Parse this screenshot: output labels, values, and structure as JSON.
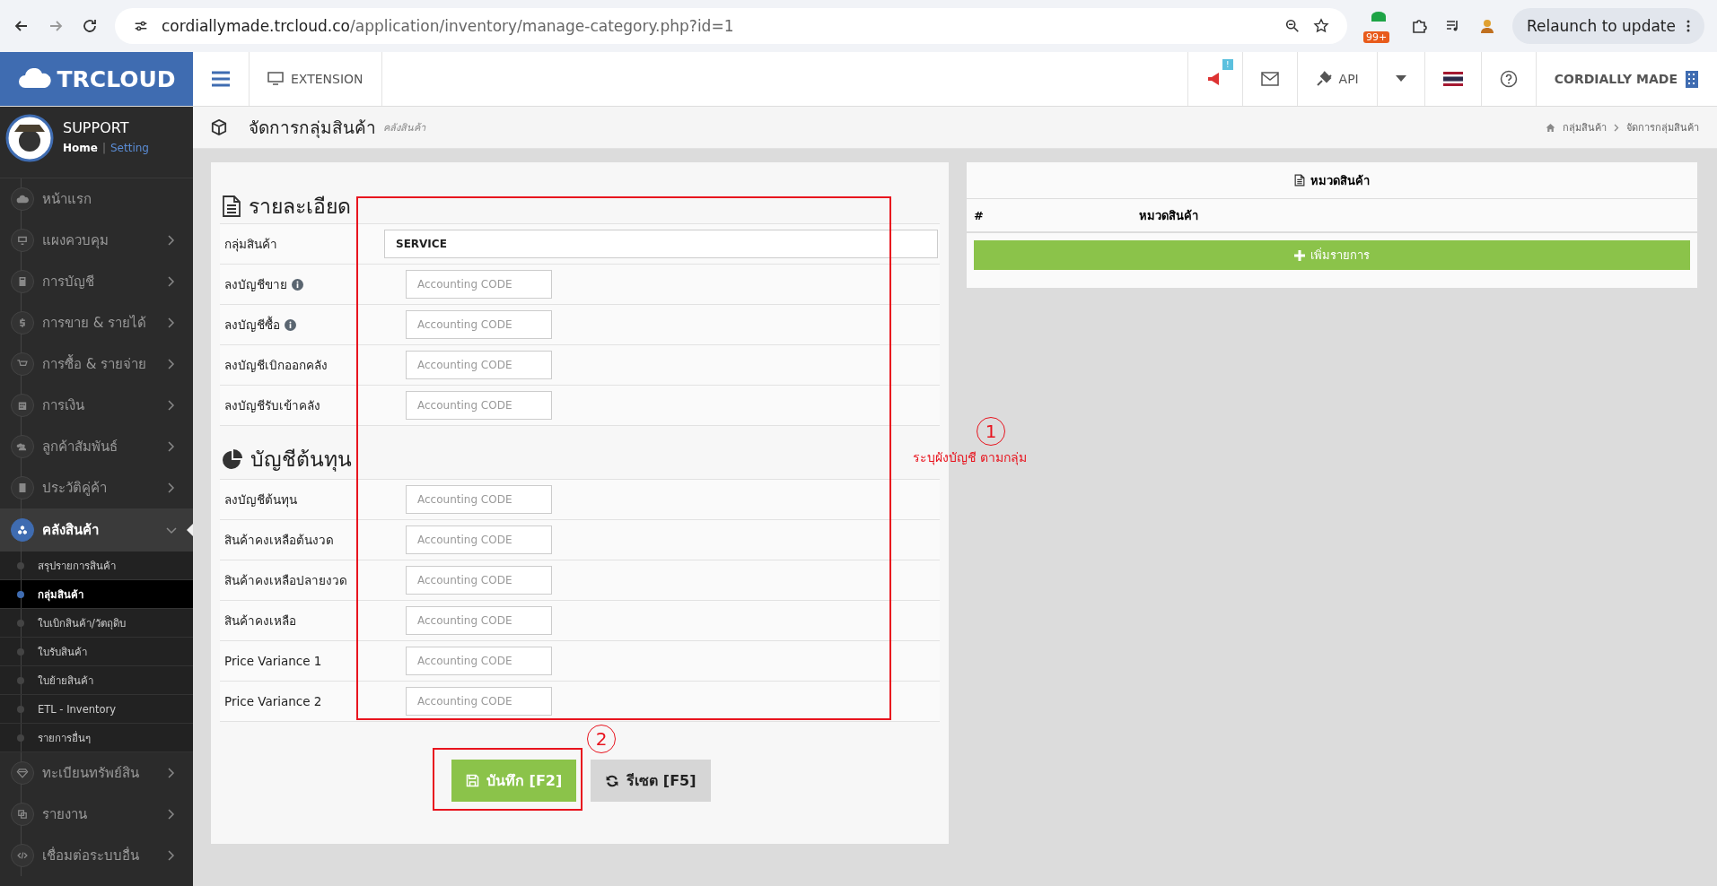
{
  "browser": {
    "url_host": "cordiallymade.trcloud.co",
    "url_path": "/application/inventory/manage-category.php?id=1",
    "extension_badge": "99+",
    "relaunch": "Relaunch to update"
  },
  "header": {
    "logo": "TRCLOUD",
    "extension": "EXTENSION",
    "notification_badge": "!",
    "api": "API",
    "company": "CORDIALLY MADE"
  },
  "user": {
    "name": "SUPPORT",
    "links": [
      {
        "label": "Home",
        "selected": true
      },
      {
        "label": "Setting",
        "selected": false
      }
    ],
    "separator": "|"
  },
  "sidebar": {
    "items": [
      {
        "label": "หน้าแรก",
        "selected": false
      },
      {
        "label": "แผงควบคุม",
        "selected": false,
        "expanded": false
      },
      {
        "label": "การบัญชี",
        "selected": false,
        "expanded": false
      },
      {
        "label": "การขาย & รายได้",
        "selected": false,
        "expanded": false
      },
      {
        "label": "การซื้อ & รายจ่าย",
        "selected": false,
        "expanded": false
      },
      {
        "label": "การเงิน",
        "selected": false,
        "expanded": false
      },
      {
        "label": "ลูกค้าสัมพันธ์",
        "selected": false,
        "expanded": false
      },
      {
        "label": "ประวัติคู่ค้า",
        "selected": false,
        "expanded": false
      },
      {
        "label": "คลังสินค้า",
        "selected": true,
        "expanded": true,
        "children": [
          {
            "label": "สรุปรายการสินค้า",
            "selected": false
          },
          {
            "label": "กลุ่มสินค้า",
            "selected": true
          },
          {
            "label": "ใบเบิกสินค้า/วัตถุดิบ",
            "selected": false
          },
          {
            "label": "ใบรับสินค้า",
            "selected": false
          },
          {
            "label": "ใบย้ายสินค้า",
            "selected": false
          },
          {
            "label": "ETL - Inventory",
            "selected": false
          },
          {
            "label": "รายการอื่นๆ",
            "selected": false
          }
        ]
      },
      {
        "label": "ทะเบียนทรัพย์สิน",
        "selected": false,
        "expanded": false
      },
      {
        "label": "รายงาน",
        "selected": false,
        "expanded": false
      },
      {
        "label": "เชื่อมต่อระบบอื่น",
        "selected": false,
        "expanded": false
      }
    ]
  },
  "page_header": {
    "title": "จัดการกลุ่มสินค้า",
    "subtitle": "คลังสินค้า",
    "breadcrumb": [
      "กลุ่มสินค้า",
      "จัดการกลุ่มสินค้า"
    ]
  },
  "form": {
    "sections": [
      {
        "title": "รายละเอียด",
        "rows": [
          {
            "kind": "text",
            "label": "กลุ่มสินค้า",
            "value": "SERVICE",
            "info": false
          },
          {
            "kind": "code",
            "label": "ลงบัญชีขาย",
            "placeholder": "Accounting CODE",
            "info": true
          },
          {
            "kind": "code",
            "label": "ลงบัญชีซื้อ",
            "placeholder": "Accounting CODE",
            "info": true
          },
          {
            "kind": "code",
            "label": "ลงบัญชีเบิกออกคลัง",
            "placeholder": "Accounting CODE",
            "info": false
          },
          {
            "kind": "code",
            "label": "ลงบัญชีรับเข้าคลัง",
            "placeholder": "Accounting CODE",
            "info": false
          }
        ]
      },
      {
        "title": "บัญชีต้นทุน",
        "rows": [
          {
            "kind": "code",
            "label": "ลงบัญชีต้นทุน",
            "placeholder": "Accounting CODE",
            "info": false
          },
          {
            "kind": "code",
            "label": "สินค้าคงเหลือต้นงวด",
            "placeholder": "Accounting CODE",
            "info": false
          },
          {
            "kind": "code",
            "label": "สินค้าคงเหลือปลายงวด",
            "placeholder": "Accounting CODE",
            "info": false
          },
          {
            "kind": "code",
            "label": "สินค้าคงเหลือ",
            "placeholder": "Accounting CODE",
            "info": false
          },
          {
            "kind": "code",
            "label": "Price Variance 1",
            "placeholder": "Accounting CODE",
            "info": false
          },
          {
            "kind": "code",
            "label": "Price Variance 2",
            "placeholder": "Accounting CODE",
            "info": false
          }
        ]
      }
    ],
    "buttons": {
      "save": "บันทึก [F2]",
      "reset": "รีเซต [F5]"
    }
  },
  "category_panel": {
    "title": "หมวดสินค้า",
    "columns": [
      "#",
      "หมวดสินค้า"
    ],
    "add_button": "เพิ่มรายการ"
  },
  "annotations": [
    {
      "number": "1",
      "text": "ระบุผังบัญชี ตามกลุ่ม"
    },
    {
      "number": "2"
    }
  ]
}
